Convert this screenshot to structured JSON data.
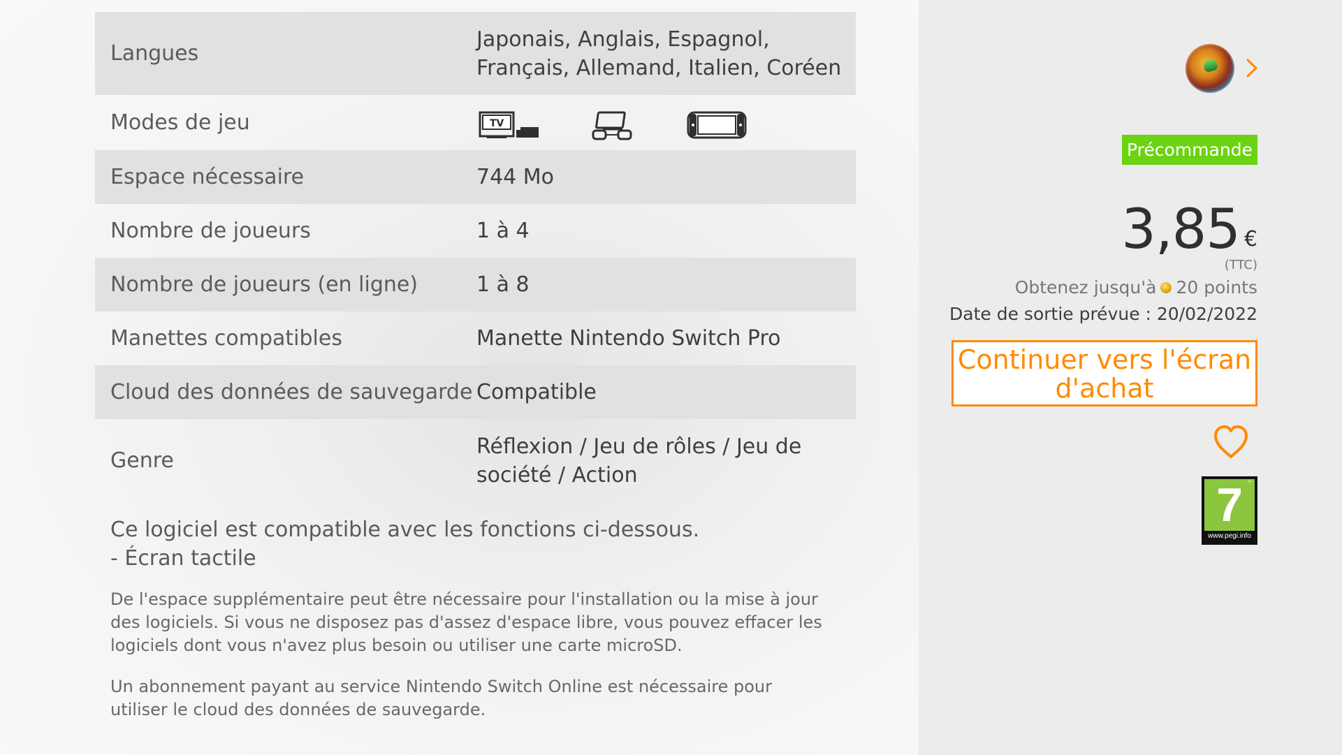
{
  "details": {
    "rows": [
      {
        "label": "Langues",
        "value": "Japonais, Anglais, Espagnol, Français, Allemand, Italien, Coréen"
      },
      {
        "label": "Modes de jeu",
        "value": ""
      },
      {
        "label": "Espace nécessaire",
        "value": "744 Mo"
      },
      {
        "label": "Nombre de joueurs",
        "value": "1 à 4"
      },
      {
        "label": "Nombre de joueurs (en ligne)",
        "value": "1 à 8"
      },
      {
        "label": "Manettes compatibles",
        "value": "Manette Nintendo Switch Pro"
      },
      {
        "label": "Cloud des données de sauvegarde",
        "value": "Compatible"
      },
      {
        "label": "Genre",
        "value": "Réflexion / Jeu de rôles / Jeu de société / Action"
      }
    ],
    "play_mode_icons": [
      "tv-mode-icon",
      "tabletop-mode-icon",
      "handheld-mode-icon"
    ],
    "tv_label": "TV"
  },
  "compat": {
    "line1": "Ce logiciel est compatible avec les fonctions ci-dessous.",
    "line2": "- Écran tactile"
  },
  "notes": {
    "note1": "De l'espace supplémentaire peut être nécessaire pour l'installation ou la mise à jour des logiciels. Si vous ne disposez pas d'assez d'espace libre, vous pouvez effacer les logiciels dont vous n'avez plus besoin ou utiliser une carte microSD.",
    "note2": "Un abonnement payant au service Nintendo Switch Online est nécessaire pour utiliser le cloud des données de sauvegarde."
  },
  "sidebar": {
    "badge": "Précommande",
    "price": "3,85",
    "currency": "€",
    "tax_note": "(TTC)",
    "points_prefix": "Obtenez jusqu'à",
    "points_value": "20 points",
    "release_date": "Date de sortie prévue : 20/02/2022",
    "purchase_button": "Continuer vers l'écran d'achat",
    "rating_age": "7",
    "rating_tm": "™",
    "rating_url": "www.pegi.info",
    "icons": {
      "avatar": "user-avatar-icon",
      "chevron": "chevron-right-icon",
      "coin": "gold-points-icon",
      "wishlist": "heart-icon",
      "rating": "pegi-rating-icon"
    },
    "colors": {
      "badge": "#6cd313",
      "button": "#ff8a00",
      "rating": "#8cc63f"
    }
  }
}
